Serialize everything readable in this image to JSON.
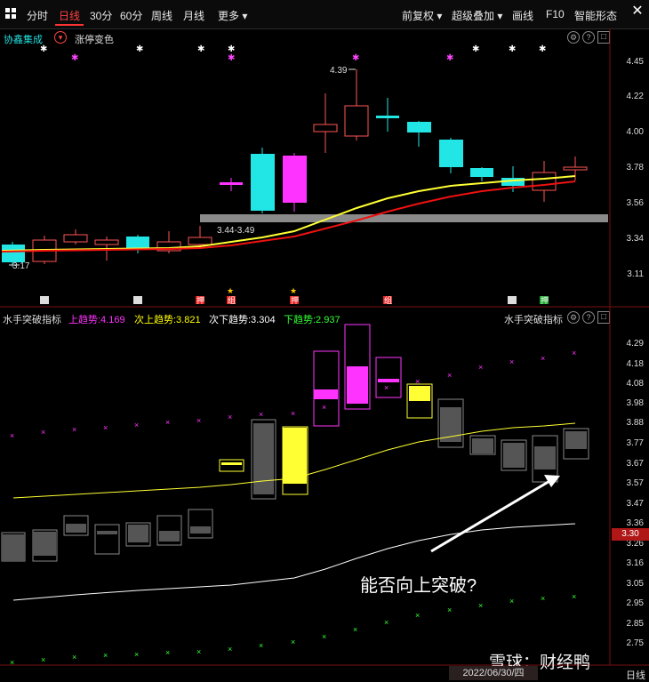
{
  "toolbar": {
    "items": [
      "分时",
      "日线",
      "30分",
      "60分",
      "周线",
      "月线",
      "更多 ▾"
    ],
    "right_items": [
      "前复权 ▾",
      "超级叠加 ▾",
      "画线",
      "F10",
      "智能形态"
    ]
  },
  "main_panel": {
    "stock_name": "协鑫集成",
    "mode_label": "涨停变色",
    "high_label": "4.39",
    "low_label": "3.17",
    "range_label": "3.44-3.49",
    "y_axis": [
      "4.45",
      "4.22",
      "4.00",
      "3.78",
      "3.56",
      "3.34",
      "3.11"
    ],
    "marker_labels": [
      "押",
      "组",
      "押",
      "组",
      "押"
    ]
  },
  "indicator_panel": {
    "name": "水手突破指标",
    "name_right": "水手突破指标",
    "up_trend_label": "上趋势:4.169",
    "up_trend_2_label": "次上趋势:3.821",
    "down_trend_2_label": "次下趋势:3.304",
    "down_trend_label": "下趋势:2.937",
    "y_axis": [
      "4.29",
      "4.18",
      "4.08",
      "3.98",
      "3.88",
      "3.77",
      "3.67",
      "3.57",
      "3.47",
      "3.36",
      "3.26",
      "3.16",
      "3.05",
      "2.95",
      "2.85",
      "2.75"
    ],
    "current_price": "3.30",
    "annotation": "能否向上突破?",
    "colors": {
      "up": "#ff33ff",
      "up2": "#ffff00",
      "down2": "#ffffff",
      "down": "#33ff33"
    }
  },
  "footer": {
    "date": "2022/06/30/四",
    "period": "日线",
    "watermark": "雪球：财经鸭"
  }
}
